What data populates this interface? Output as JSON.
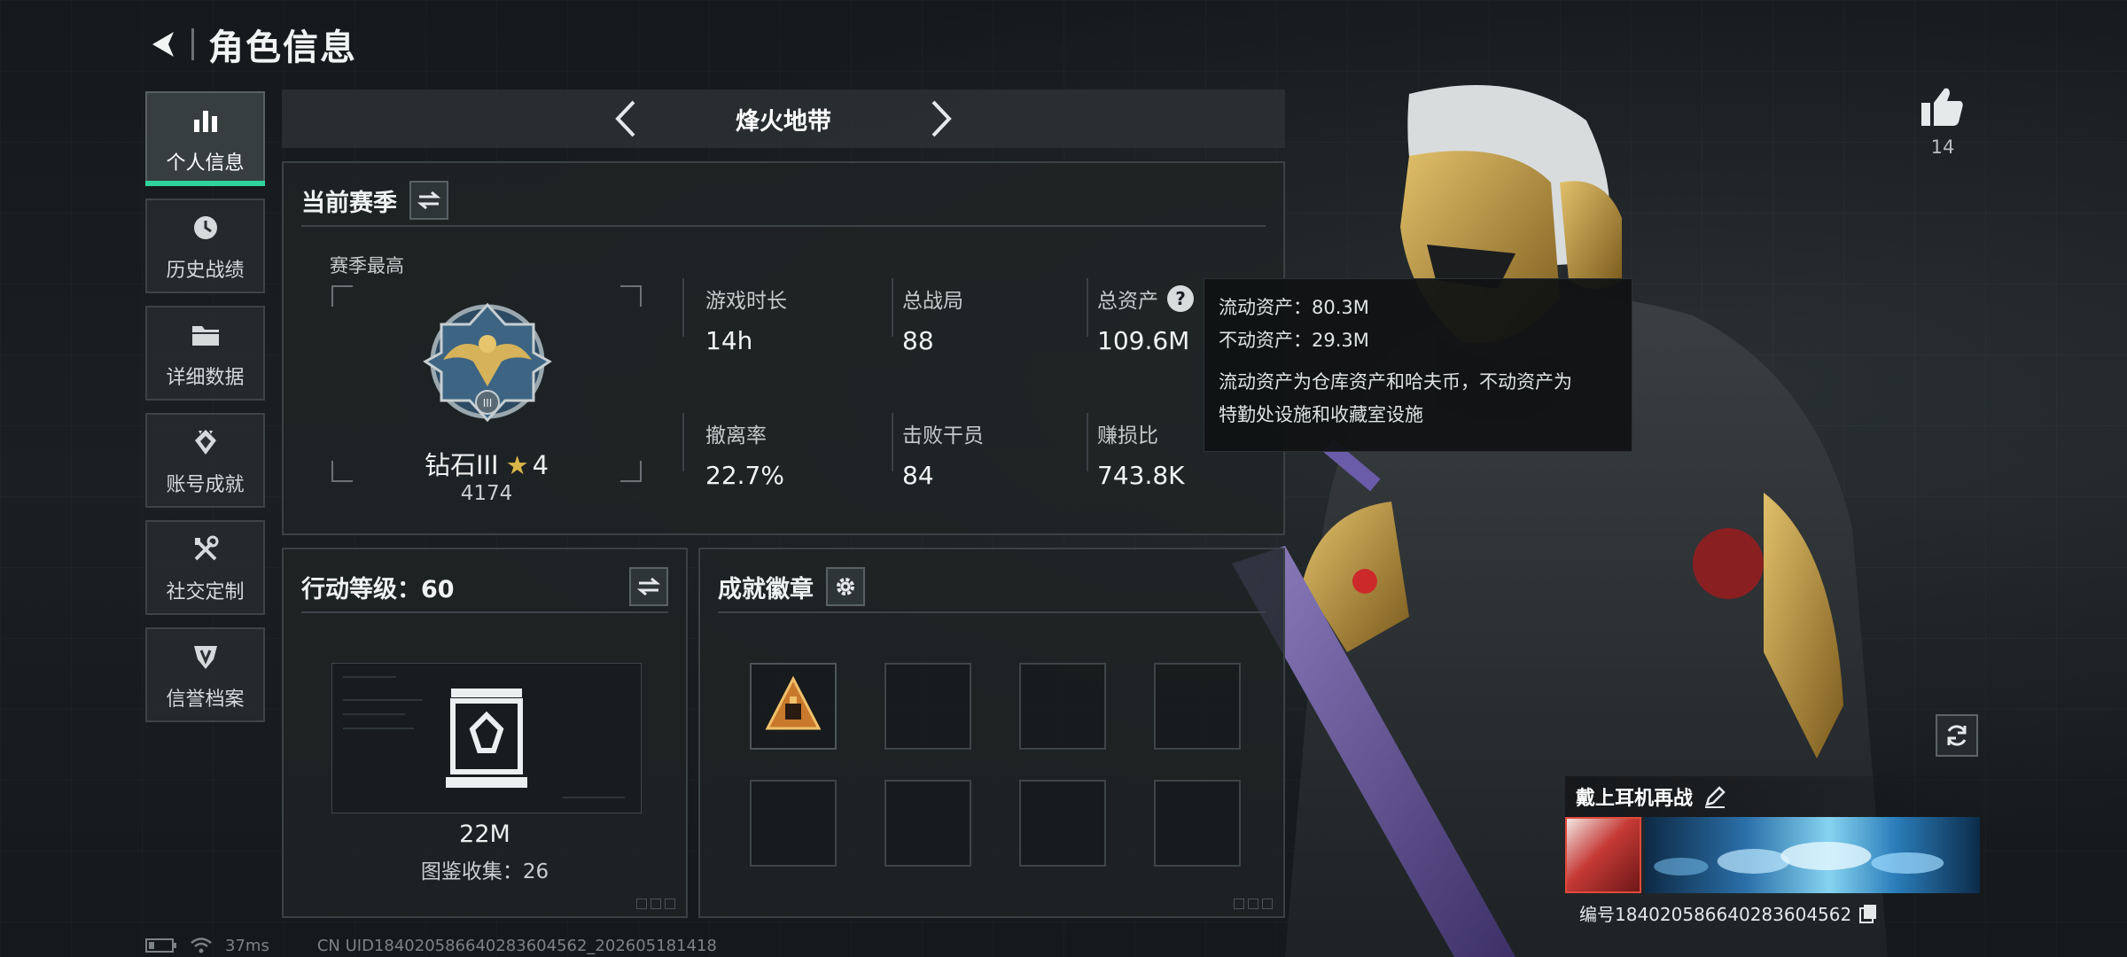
{
  "header": {
    "title": "角色信息",
    "back_icon": "back-arrow-icon"
  },
  "sidebar": {
    "items": [
      {
        "label": "个人信息",
        "icon": "bar-chart-icon",
        "active": true
      },
      {
        "label": "历史战绩",
        "icon": "clock-icon",
        "active": false
      },
      {
        "label": "详细数据",
        "icon": "folder-icon",
        "active": false
      },
      {
        "label": "账号成就",
        "icon": "achievement-icon",
        "active": false
      },
      {
        "label": "社交定制",
        "icon": "tools-icon",
        "active": false
      },
      {
        "label": "信誉档案",
        "icon": "shield-icon",
        "active": false
      }
    ],
    "accent_color": "#2fd39b"
  },
  "mode": {
    "title": "烽火地带"
  },
  "season": {
    "title": "当前赛季",
    "best_label": "赛季最高",
    "rank_name": "钻石III",
    "rank_stars": "4",
    "rank_score": "4174",
    "stats": [
      {
        "label": "游戏时长",
        "value": "14h"
      },
      {
        "label": "总战局",
        "value": "88"
      },
      {
        "label": "总资产",
        "value": "109.6M"
      },
      {
        "label": "撤离率",
        "value": "22.7%"
      },
      {
        "label": "击败干员",
        "value": "84"
      },
      {
        "label": "赚损比",
        "value": "743.8K"
      }
    ]
  },
  "tooltip": {
    "liquid": "流动资产：80.3M",
    "fixed": "不动资产：29.3M",
    "desc_line1": "流动资产为仓库资产和哈夫币，不动资产为",
    "desc_line2": "特勤处设施和收藏室设施"
  },
  "level": {
    "title": "行动等级：60",
    "money": "22M",
    "collection": "图鉴收集：26"
  },
  "badges": {
    "title": "成就徽章",
    "slots": [
      {
        "filled": true,
        "icon": "pyramid-badge-icon"
      },
      {
        "filled": false
      },
      {
        "filled": false
      },
      {
        "filled": false
      },
      {
        "filled": false
      },
      {
        "filled": false
      },
      {
        "filled": false
      },
      {
        "filled": false
      }
    ]
  },
  "like": {
    "count": "14"
  },
  "player": {
    "name": "戴上耳机再战",
    "id": "编号18402058664028360456​2"
  },
  "footer": {
    "ping": "37ms",
    "uid": "CN UID18402058664028360456​2_202605181418"
  }
}
